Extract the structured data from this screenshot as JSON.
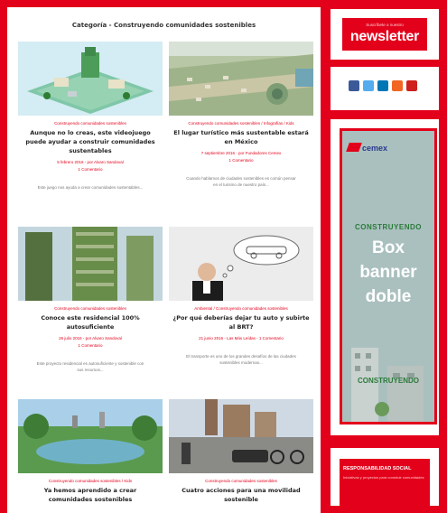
{
  "category_header": "Categoría - Construyendo comunidades sostenibles",
  "articles": [
    {
      "category": "Construyendo comunidades sostenibles",
      "title": "Aunque no lo creas, este videojuego puede ayudar a construir comunidades sustentables",
      "meta": "5 febrero 2016 - por Alvaro Sandoval",
      "comments": "1 Comentario",
      "excerpt": "Este juego nos ayuda a crear comunidades sustentables..."
    },
    {
      "category": "Construyendo comunidades sostenibles / Infografías / Kids",
      "title": "El lugar turístico más sustentable estará en México",
      "meta": "7 septiembre 2016 - por Fundadores Cemex",
      "comments": "1 Comentario",
      "excerpt": "Cuando hablamos de ciudades sostenibles es común pensar en el turismo de nuestro país..."
    },
    {
      "category": "Construyendo comunidades sostenibles",
      "title": "Conoce este residencial 100% autosuficiente",
      "meta": "26 julio 2016 - por Alvaro Sandoval",
      "comments": "1 Comentario",
      "excerpt": "Este proyecto residencial es autosuficiente y sostenible con sus recursos..."
    },
    {
      "category": "Ambiental / Construyendo comunidades sostenibles",
      "title": "¿Por qué deberías dejar tu auto y subirte al BRT?",
      "meta": "21 junio 2016 - Las Más Leídas - 1 Comentario",
      "comments": "",
      "excerpt": "El transporte es uno de los grandes desafíos de las ciudades sostenibles modernas..."
    },
    {
      "category": "Construyendo comunidades sostenibles / Kids",
      "title": "Ya hemos aprendido a crear comunidades sostenibles",
      "meta": "",
      "comments": "",
      "excerpt": ""
    },
    {
      "category": "Construyendo comunidades sostenibles",
      "title": "Cuatro acciones para una movilidad sostenible",
      "meta": "",
      "comments": "",
      "excerpt": ""
    }
  ],
  "sidebar": {
    "newsletter_small": "Suscríbete a nuestro",
    "newsletter_big": "newsletter",
    "social_icons": [
      "facebook-icon",
      "twitter-icon",
      "linkedin-icon",
      "rss-icon",
      "youtube-icon"
    ],
    "social_colors": [
      "#3b5998",
      "#55acee",
      "#0077b5",
      "#f26522",
      "#cd201f"
    ],
    "cemex_logo": "cemex",
    "construyendo_top": "CONSTRUYENDO",
    "box_line1": "Box",
    "box_line2": "banner",
    "box_line3": "doble",
    "construyendo_bottom": "CONSTRUYENDO",
    "responsabilidad_title": "RESPONSABILIDAD SOCIAL",
    "responsabilidad_sub": "Iniciativas y proyectos para construir comunidades"
  },
  "colors": {
    "brand_red": "#e3001b",
    "cemex_blue": "#2a3a8c"
  }
}
